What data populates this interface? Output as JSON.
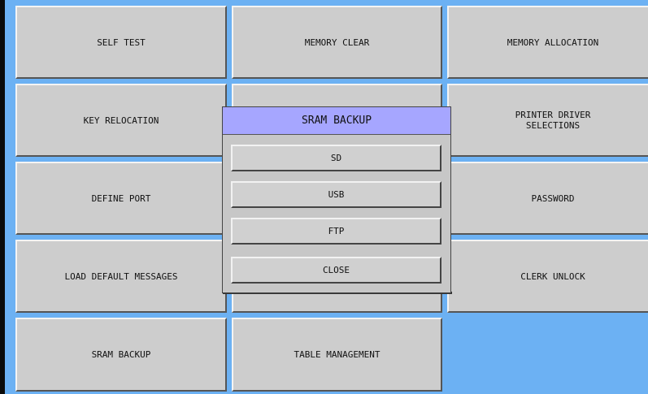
{
  "menu": {
    "self_test": "SELF TEST",
    "memory_clear": "MEMORY CLEAR",
    "memory_allocation": "MEMORY ALLOCATION",
    "key_relocation": "KEY RELOCATION",
    "printer_driver_selections": "PRINTER DRIVER\nSELECTIONS",
    "define_port": "DEFINE PORT",
    "password": "PASSWORD",
    "load_default_messages": "LOAD DEFAULT MESSAGES",
    "clerk_unlock": "CLERK UNLOCK",
    "sram_backup": "SRAM BACKUP",
    "table_management": "TABLE MANAGEMENT"
  },
  "dialog": {
    "title": "SRAM BACKUP",
    "options": [
      "SD",
      "USB",
      "FTP"
    ],
    "close_label": "CLOSE"
  },
  "colors": {
    "background": "#6cb1f3",
    "button_face": "#cdcdcd",
    "dialog_title_bar": "#a6a6ff"
  }
}
